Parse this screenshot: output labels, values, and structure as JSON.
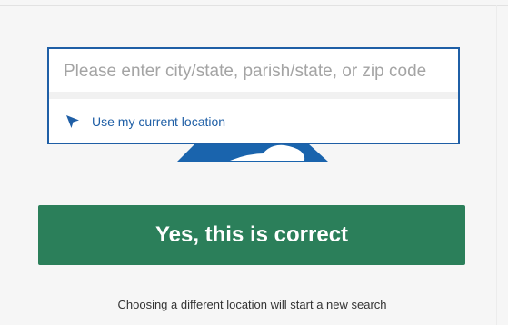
{
  "search": {
    "placeholder": "Please enter city/state, parish/state, or zip code",
    "value": ""
  },
  "location_option": {
    "label": "Use my current location",
    "icon": "location-arrow-icon"
  },
  "confirm_button": {
    "label": "Yes, this is correct"
  },
  "footer": {
    "note": "Choosing a different location will start a new search"
  },
  "colors": {
    "accent_blue": "#1f5fa6",
    "confirm_green": "#2b7f5a",
    "background": "#f6f6f6"
  }
}
